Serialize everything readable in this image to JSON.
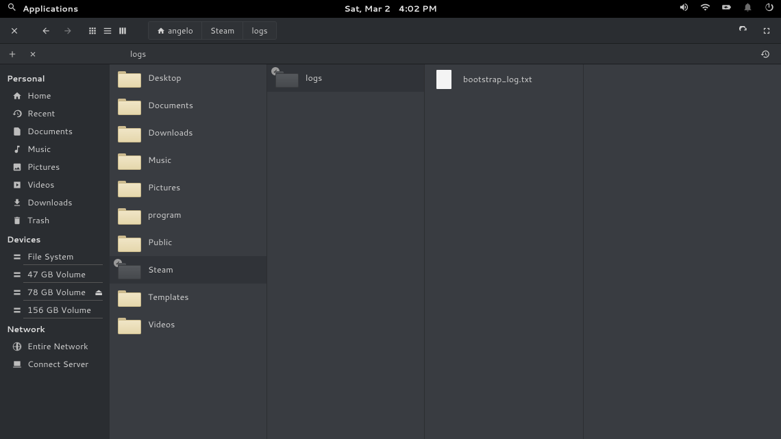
{
  "panel": {
    "applications_label": "Applications",
    "date": "Sat, Mar  2",
    "time": "4:02 PM"
  },
  "toolbar": {
    "breadcrumbs": [
      "angelo",
      "Steam",
      "logs"
    ]
  },
  "tabs": {
    "active_label": "logs"
  },
  "sidebar": {
    "sections": [
      {
        "title": "Personal",
        "items": [
          {
            "icon": "home",
            "label": "Home"
          },
          {
            "icon": "recent",
            "label": "Recent"
          },
          {
            "icon": "documents",
            "label": "Documents"
          },
          {
            "icon": "music",
            "label": "Music"
          },
          {
            "icon": "pictures",
            "label": "Pictures"
          },
          {
            "icon": "videos",
            "label": "Videos"
          },
          {
            "icon": "downloads",
            "label": "Downloads"
          },
          {
            "icon": "trash",
            "label": "Trash"
          }
        ]
      },
      {
        "title": "Devices",
        "items": [
          {
            "icon": "drive",
            "label": "File System",
            "vol": true
          },
          {
            "icon": "drive",
            "label": "47 GB Volume",
            "vol": true
          },
          {
            "icon": "drive",
            "label": "78 GB Volume",
            "vol": true,
            "eject": true
          },
          {
            "icon": "drive",
            "label": "156 GB Volume",
            "vol": true
          }
        ]
      },
      {
        "title": "Network",
        "items": [
          {
            "icon": "network",
            "label": "Entire Network"
          },
          {
            "icon": "connect",
            "label": "Connect Server"
          }
        ]
      }
    ]
  },
  "columns": [
    {
      "entries": [
        {
          "type": "folder",
          "label": "Desktop"
        },
        {
          "type": "folder",
          "label": "Documents"
        },
        {
          "type": "folder",
          "label": "Downloads"
        },
        {
          "type": "folder",
          "label": "Music"
        },
        {
          "type": "folder",
          "label": "Pictures"
        },
        {
          "type": "folder",
          "label": "program"
        },
        {
          "type": "folder",
          "label": "Public"
        },
        {
          "type": "folder-dark",
          "label": "Steam",
          "selected": true,
          "badge": true
        },
        {
          "type": "folder",
          "label": "Templates"
        },
        {
          "type": "folder",
          "label": "Videos"
        }
      ]
    },
    {
      "entries": [
        {
          "type": "folder-dark",
          "label": "logs",
          "selected": true,
          "badge": true
        }
      ]
    },
    {
      "entries": [
        {
          "type": "file",
          "label": "bootstrap_log.txt"
        }
      ]
    }
  ]
}
